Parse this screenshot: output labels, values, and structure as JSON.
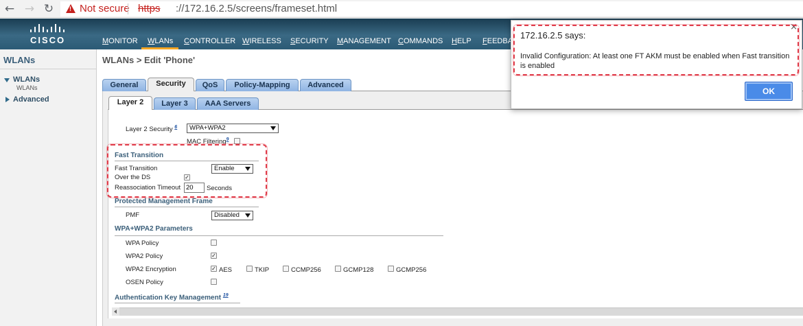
{
  "browser": {
    "not_secure": "Not secure",
    "url_protocol": "https",
    "url_rest": "://172.16.2.5/screens/frameset.html"
  },
  "header": {
    "logo": "CISCO",
    "menu": [
      {
        "first": "M",
        "rest": "ONITOR"
      },
      {
        "first": "W",
        "rest": "LANs"
      },
      {
        "first": "C",
        "rest": "ONTROLLER"
      },
      {
        "first": "W",
        "rest": "IRELESS"
      },
      {
        "first": "S",
        "rest": "ECURITY"
      },
      {
        "first": "M",
        "rest": "ANAGEMENT"
      },
      {
        "first": "C",
        "rest": "OMMANDS"
      },
      {
        "first": "H",
        "rest": "ELP"
      },
      {
        "first": "F",
        "rest": "EEDBAC"
      }
    ]
  },
  "sidebar": {
    "title": "WLANs",
    "wlans_label": "WLANs",
    "wlans_sub": "WLANs",
    "advanced_label": "Advanced"
  },
  "page": {
    "title": "WLANs > Edit  'Phone'"
  },
  "tabs": [
    "General",
    "Security",
    "QoS",
    "Policy-Mapping",
    "Advanced"
  ],
  "subtabs": [
    "Layer 2",
    "Layer 3",
    "AAA Servers"
  ],
  "layer2": {
    "layer2_security_label": "Layer 2 Security",
    "layer2_security_sup": "6",
    "layer2_security_value": "WPA+WPA2",
    "mac_filtering_label": "MAC Filtering",
    "mac_filtering_sup": "9",
    "fast_transition_title": "Fast Transition",
    "fast_transition_label": "Fast Transition",
    "fast_transition_value": "Enable",
    "over_ds_label": "Over the DS",
    "reassoc_label": "Reassociation Timeout",
    "reassoc_value": "20",
    "reassoc_unit": "Seconds",
    "pmf_title": "Protected Management Frame",
    "pmf_label": "PMF",
    "pmf_value": "Disabled",
    "wpa_params_title": "WPA+WPA2 Parameters",
    "wpa_policy_label": "WPA Policy",
    "wpa2_policy_label": "WPA2 Policy",
    "wpa2_encryption_label": "WPA2 Encryption",
    "enc_aes": "AES",
    "enc_tkip": "TKIP",
    "enc_ccmp256": "CCMP256",
    "enc_gcmp128": "GCMP128",
    "enc_gcmp256": "GCMP256",
    "osen_policy_label": "OSEN Policy",
    "akm_title": "Authentication Key Management",
    "akm_sup": "19"
  },
  "dialog": {
    "title": "172.16.2.5 says:",
    "message": "Invalid Configuration: At least one FT AKM must be enabled when Fast transition is enabled",
    "ok_label": "OK"
  },
  "colors": {
    "highlight_box": "#e03c4a",
    "header_bg": "#2b5a75",
    "tab_blue": "#8fb4e3",
    "ok_button": "#4a8be8"
  }
}
